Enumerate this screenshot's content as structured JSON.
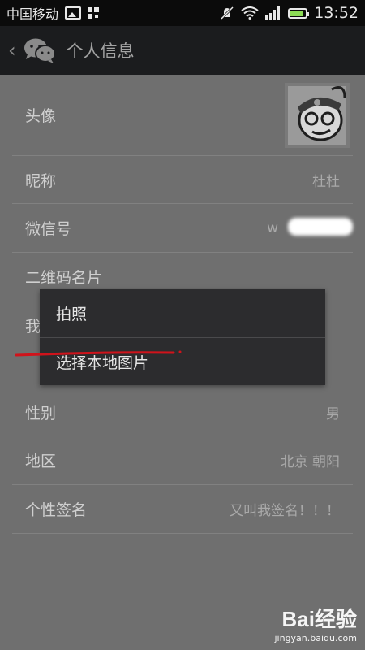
{
  "status_bar": {
    "carrier": "中国移动",
    "time": "13:52",
    "battery_level": 0.9
  },
  "header": {
    "title": "个人信息"
  },
  "rows": [
    {
      "label": "头像",
      "value": ""
    },
    {
      "label": "昵称",
      "value": "杜杜"
    },
    {
      "label": "微信号",
      "value": "w"
    },
    {
      "label": "二维码名片",
      "value": ""
    },
    {
      "label": "我",
      "value": ""
    },
    {
      "label": "性别",
      "value": "男"
    },
    {
      "label": "地区",
      "value": "北京 朝阳"
    },
    {
      "label": "个性签名",
      "value": "又叫我签名！！！"
    }
  ],
  "menu": {
    "items": [
      "拍照",
      "选择本地图片"
    ]
  },
  "watermark": {
    "logo": "Bai经验",
    "url": "jingyan.baidu.com"
  },
  "colors": {
    "overlay": "#6f6f6f",
    "menu_bg": "#2c2c2e",
    "underline": "#d0131b"
  }
}
